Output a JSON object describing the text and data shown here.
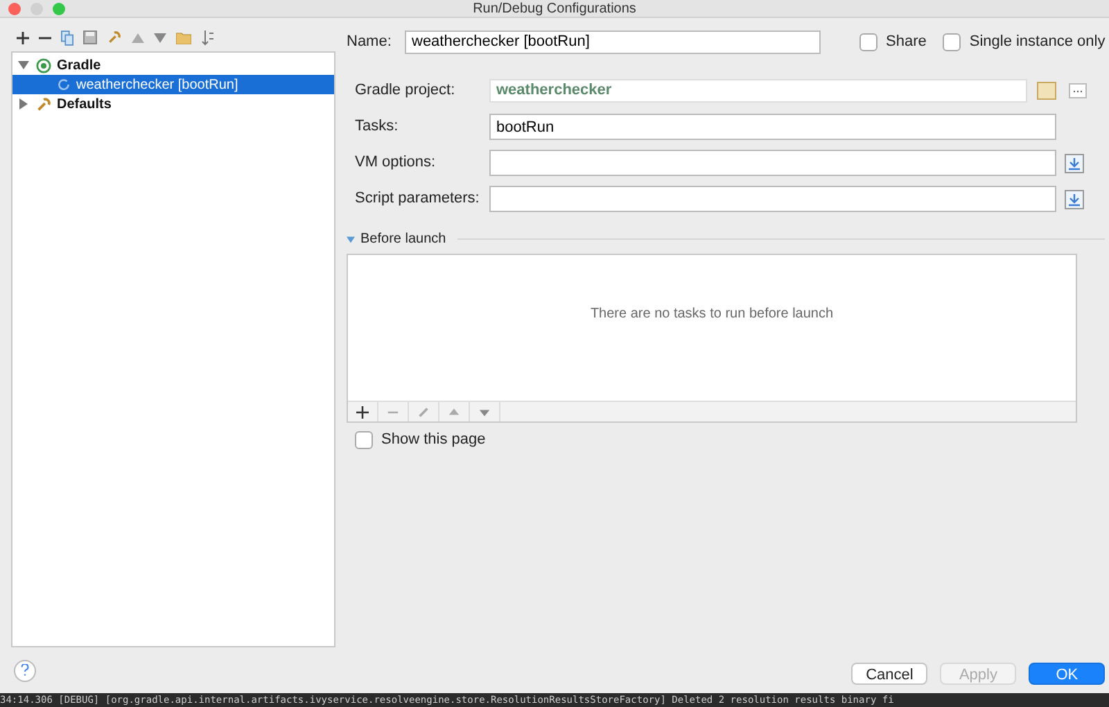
{
  "window": {
    "title": "Run/Debug Configurations"
  },
  "tree": [
    {
      "label": "Gradle",
      "kind": "gradle",
      "expanded": true,
      "selected": false,
      "children": [
        {
          "label": "weatherchecker [bootRun]",
          "kind": "run",
          "selected": true
        }
      ]
    },
    {
      "label": "Defaults",
      "kind": "defaults",
      "expanded": false,
      "selected": false
    }
  ],
  "name": {
    "label": "Name:",
    "value": "weatherchecker [bootRun]"
  },
  "options": [
    {
      "label": "Share",
      "checked": false
    },
    {
      "label": "Single instance only",
      "checked": false
    }
  ],
  "fields": [
    {
      "label": "Gradle project:",
      "value": "weatherchecker",
      "kind": "project"
    },
    {
      "label": "Tasks:",
      "value": "bootRun",
      "kind": "plain"
    },
    {
      "label": "VM options:",
      "kind": "expand"
    },
    {
      "label": "Script parameters:",
      "kind": "expand"
    }
  ],
  "before_launch": {
    "title": "Before launch",
    "expanded": true,
    "empty_text": "There are no tasks to run before launch",
    "show_page": {
      "label": "Show this page",
      "checked": false
    }
  },
  "buttons": [
    {
      "label": "Cancel",
      "kind": "normal"
    },
    {
      "label": "Apply",
      "kind": "disabled"
    },
    {
      "label": "OK",
      "kind": "default"
    }
  ],
  "log_line": "34:14.306 [DEBUG] [org.gradle.api.internal.artifacts.ivyservice.resolveengine.store.ResolutionResultsStoreFactory] Deleted 2 resolution results binary fi"
}
